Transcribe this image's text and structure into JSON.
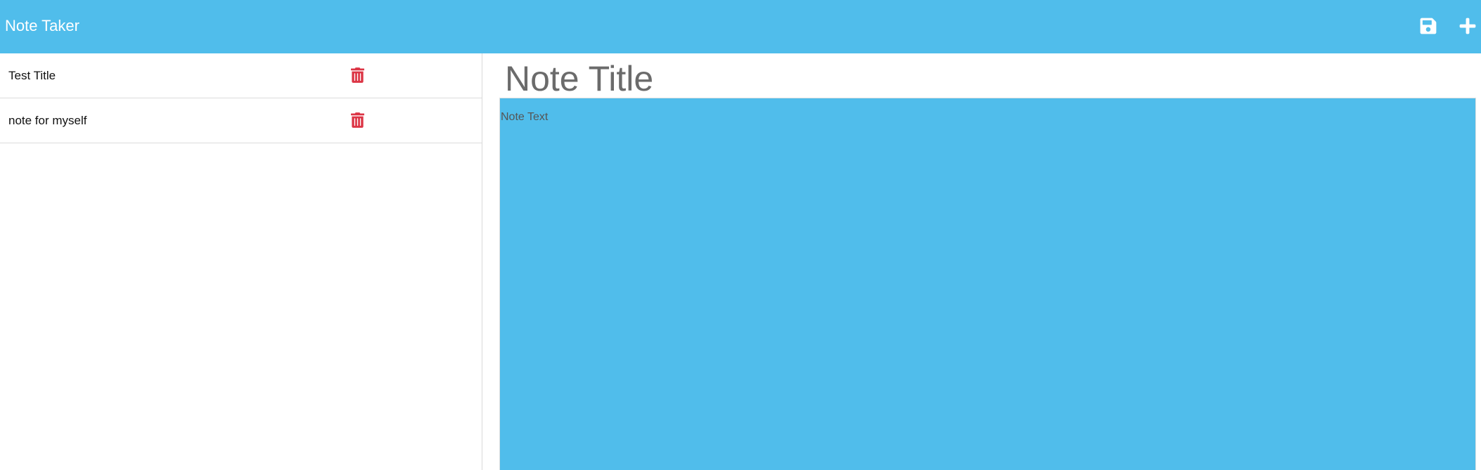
{
  "navbar": {
    "brand": "Note Taker",
    "save_icon": "save-icon",
    "new_icon": "plus-icon",
    "background_color": "#50bdeb"
  },
  "sidebar": {
    "notes": [
      {
        "title": "Test Title",
        "delete_icon": "trash-icon"
      },
      {
        "title": "note for myself",
        "delete_icon": "trash-icon"
      }
    ],
    "delete_color": "#dc3545"
  },
  "editor": {
    "title_placeholder": "Note Title",
    "text_placeholder": "Note Text",
    "text_area_color": "#50bdeb"
  }
}
